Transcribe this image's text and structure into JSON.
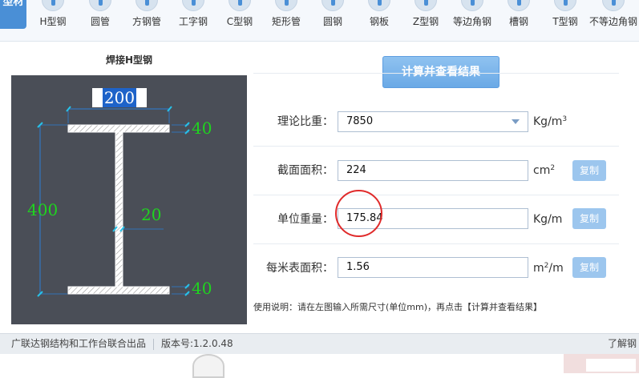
{
  "toolbar": {
    "category_label": "型材",
    "items": [
      {
        "label": "H型钢",
        "icon": "h-beam-icon"
      },
      {
        "label": "圆管",
        "icon": "round-pipe-icon"
      },
      {
        "label": "方钢管",
        "icon": "square-pipe-icon"
      },
      {
        "label": "工字钢",
        "icon": "i-beam-icon"
      },
      {
        "label": "C型钢",
        "icon": "c-channel-icon"
      },
      {
        "label": "矩形管",
        "icon": "rect-pipe-icon"
      },
      {
        "label": "圆钢",
        "icon": "round-bar-icon"
      },
      {
        "label": "钢板",
        "icon": "steel-plate-icon"
      },
      {
        "label": "Z型钢",
        "icon": "z-section-icon"
      },
      {
        "label": "等边角钢",
        "icon": "equal-angle-icon"
      },
      {
        "label": "槽钢",
        "icon": "channel-icon"
      },
      {
        "label": "T型钢",
        "icon": "t-section-icon"
      },
      {
        "label": "不等边角钢",
        "icon": "unequal-angle-icon"
      }
    ]
  },
  "drawing": {
    "title": "焊接H型钢",
    "width": "200",
    "height": "400",
    "flange_top": "40",
    "flange_bottom": "40",
    "web": "20",
    "colors": {
      "background": "#4a4e57",
      "dimension": "#1fd41f",
      "section": "#ffffff"
    }
  },
  "calc_button_label": "计算并查看结果",
  "rows": [
    {
      "label": "理论比重：",
      "value": "7850",
      "unit": "Kg/m",
      "unit_sup": "3",
      "dropdown": true
    },
    {
      "label": "截面面积：",
      "value": "224",
      "unit": "cm",
      "unit_sup": "2",
      "copy": "复制"
    },
    {
      "label": "单位重量：",
      "value": "175.84",
      "unit": "Kg/m",
      "unit_sup": "",
      "copy": "复制"
    },
    {
      "label": "每米表面积：",
      "value": "1.56",
      "unit": "m",
      "unit_sup": "2",
      "unit_tail": "/m",
      "copy": "复制"
    }
  ],
  "usage_note": "使用说明：请在左图输入所需尺寸(单位mm)，再点击【计算并查看结果】",
  "statusbar": {
    "credit": "广联达钢结构和工作台联合出品",
    "version": "版本号:1.2.0.48",
    "more": "了解钢"
  },
  "accent_color": "#4a8fd6",
  "highlight_color": "#e02a2a"
}
